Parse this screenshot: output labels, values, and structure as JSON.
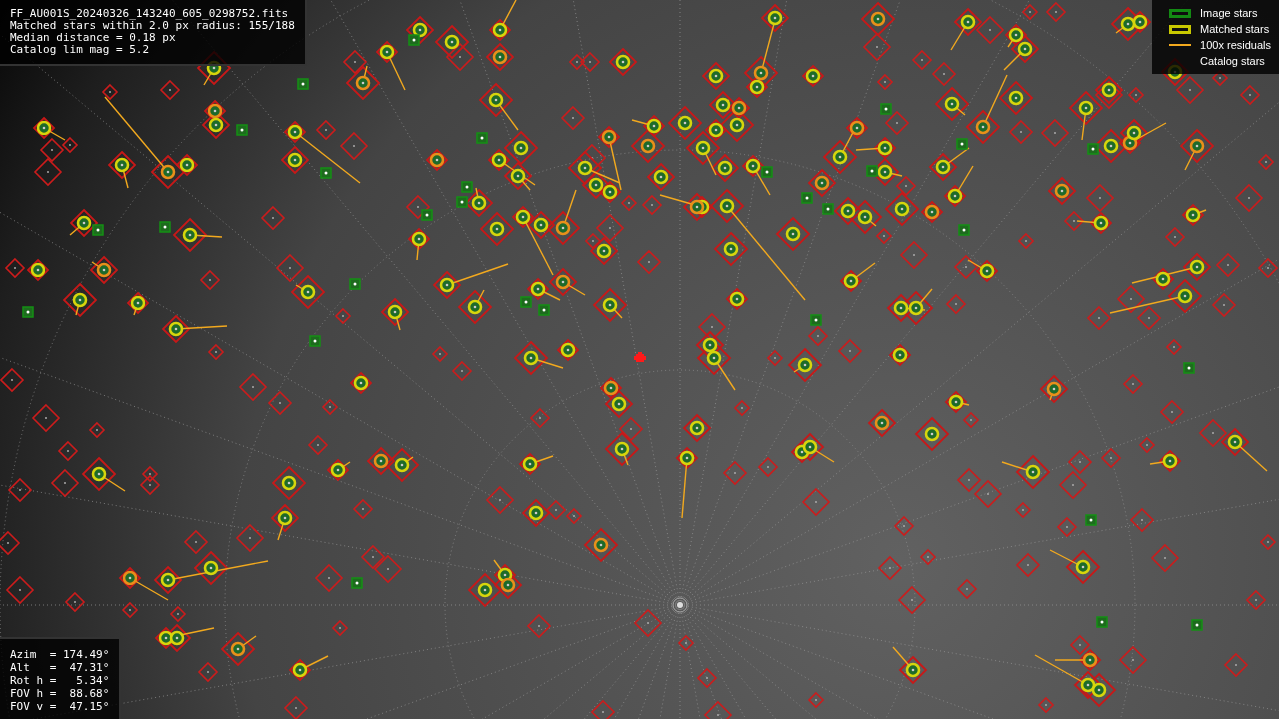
{
  "header_info": {
    "lines": [
      "FF_AU001S_20240326_143240_605_0298752.fits",
      "Matched stars within 2.0 px radius: 155/188",
      "Median distance = 0.18 px",
      "Catalog lim mag = 5.2"
    ]
  },
  "legend": {
    "items": [
      {
        "label": "Image stars",
        "kind": "image"
      },
      {
        "label": "Matched stars",
        "kind": "matched"
      },
      {
        "label": "100x residuals",
        "kind": "residual"
      },
      {
        "label": "Catalog stars",
        "kind": "catalog"
      }
    ]
  },
  "pointing_info": {
    "lines": [
      "Azim  = 174.49°",
      "Alt   =  47.31°",
      "Rot h =   5.34°",
      "FOV h =  88.68°",
      "FOV v =  47.15°"
    ]
  }
}
